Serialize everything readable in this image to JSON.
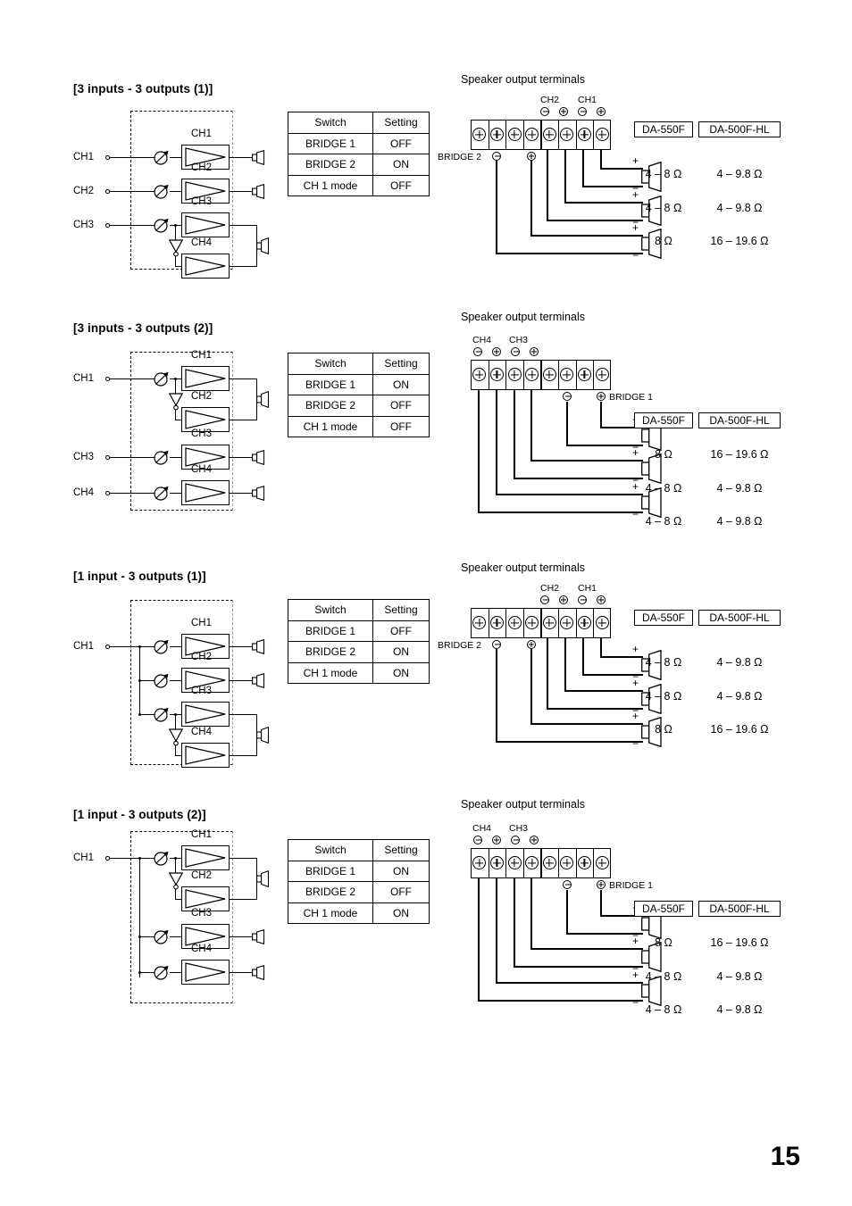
{
  "page": {
    "number": "15"
  },
  "common": {
    "speaker_terminals_label": "Speaker output terminals",
    "table_headers": {
      "switch": "Switch",
      "setting": "Setting"
    },
    "switch_names": {
      "bridge1": "BRIDGE 1",
      "bridge2": "BRIDGE 2",
      "ch1mode": "CH 1 mode"
    },
    "models": {
      "da550f": "DA-550F",
      "da500fhl": "DA-500F-HL"
    },
    "polarity": {
      "plus": "+",
      "minus": "−"
    },
    "channel_labels": {
      "ch1": "CH1",
      "ch2": "CH2",
      "ch3": "CH3",
      "ch4": "CH4"
    }
  },
  "sections": [
    {
      "title": "[3 inputs - 3 outputs (1)]",
      "speaker_terminals_label": "Speaker output terminals",
      "inputs": [
        "CH1",
        "CH2",
        "CH3"
      ],
      "amp_channels": [
        "CH1",
        "CH2",
        "CH3",
        "CH4"
      ],
      "bridged_pair": "CH3-CH4",
      "table": {
        "headers": [
          "Switch",
          "Setting"
        ],
        "rows": [
          {
            "switch": "BRIDGE 1",
            "setting": "OFF"
          },
          {
            "switch": "BRIDGE 2",
            "setting": "ON"
          },
          {
            "switch": "CH 1 mode",
            "setting": "OFF"
          }
        ]
      },
      "terminal_block": {
        "count": 8,
        "group_labels": [
          {
            "name": "CH2",
            "minus": "⊖",
            "plus": "⊕"
          },
          {
            "name": "CH1",
            "minus": "⊖",
            "plus": "⊕"
          }
        ],
        "bridge_label": "BRIDGE 2",
        "bridge_minus": "⊖",
        "bridge_plus": "⊕"
      },
      "impedance_header": [
        "DA-550F",
        "DA-500F-HL"
      ],
      "impedance_rows": [
        {
          "da550f": "4 – 8 Ω",
          "da500fhl": "4 – 9.8 Ω"
        },
        {
          "da550f": "4 – 8 Ω",
          "da500fhl": "4 – 9.8 Ω"
        },
        {
          "da550f": "8 Ω",
          "da500fhl": "16 – 19.6 Ω"
        }
      ]
    },
    {
      "title": "[3 inputs - 3 outputs (2)]",
      "speaker_terminals_label": "Speaker output terminals",
      "inputs": [
        "CH1",
        "CH3",
        "CH4"
      ],
      "amp_channels": [
        "CH1",
        "CH2",
        "CH3",
        "CH4"
      ],
      "bridged_pair": "CH1-CH2",
      "table": {
        "headers": [
          "Switch",
          "Setting"
        ],
        "rows": [
          {
            "switch": "BRIDGE 1",
            "setting": "ON"
          },
          {
            "switch": "BRIDGE 2",
            "setting": "OFF"
          },
          {
            "switch": "CH 1 mode",
            "setting": "OFF"
          }
        ]
      },
      "terminal_block": {
        "count": 8,
        "group_labels": [
          {
            "name": "CH4",
            "minus": "⊖",
            "plus": "⊕"
          },
          {
            "name": "CH3",
            "minus": "⊖",
            "plus": "⊕"
          }
        ],
        "bridge_label": "BRIDGE 1",
        "bridge_minus": "⊖",
        "bridge_plus": "⊕"
      },
      "impedance_header": [
        "DA-550F",
        "DA-500F-HL"
      ],
      "impedance_rows": [
        {
          "da550f": "8 Ω",
          "da500fhl": "16 – 19.6 Ω"
        },
        {
          "da550f": "4 – 8 Ω",
          "da500fhl": "4 – 9.8 Ω"
        },
        {
          "da550f": "4 – 8 Ω",
          "da500fhl": "4 – 9.8 Ω"
        }
      ]
    },
    {
      "title": "[1 input - 3 outputs (1)]",
      "speaker_terminals_label": "Speaker output terminals",
      "inputs": [
        "CH1"
      ],
      "amp_channels": [
        "CH1",
        "CH2",
        "CH3",
        "CH4"
      ],
      "bridged_pair": "CH3-CH4",
      "table": {
        "headers": [
          "Switch",
          "Setting"
        ],
        "rows": [
          {
            "switch": "BRIDGE 1",
            "setting": "OFF"
          },
          {
            "switch": "BRIDGE 2",
            "setting": "ON"
          },
          {
            "switch": "CH 1 mode",
            "setting": "ON"
          }
        ]
      },
      "terminal_block": {
        "count": 8,
        "group_labels": [
          {
            "name": "CH2",
            "minus": "⊖",
            "plus": "⊕"
          },
          {
            "name": "CH1",
            "minus": "⊖",
            "plus": "⊕"
          }
        ],
        "bridge_label": "BRIDGE 2",
        "bridge_minus": "⊖",
        "bridge_plus": "⊕"
      },
      "impedance_header": [
        "DA-550F",
        "DA-500F-HL"
      ],
      "impedance_rows": [
        {
          "da550f": "4 – 8 Ω",
          "da500fhl": "4 – 9.8 Ω"
        },
        {
          "da550f": "4 – 8 Ω",
          "da500fhl": "4 – 9.8 Ω"
        },
        {
          "da550f": "8 Ω",
          "da500fhl": "16 – 19.6 Ω"
        }
      ]
    },
    {
      "title": "[1 input - 3 outputs (2)]",
      "speaker_terminals_label": "Speaker output terminals",
      "inputs": [
        "CH1"
      ],
      "amp_channels": [
        "CH1",
        "CH2",
        "CH3",
        "CH4"
      ],
      "bridged_pair": "CH1-CH2",
      "table": {
        "headers": [
          "Switch",
          "Setting"
        ],
        "rows": [
          {
            "switch": "BRIDGE 1",
            "setting": "ON"
          },
          {
            "switch": "BRIDGE 2",
            "setting": "OFF"
          },
          {
            "switch": "CH 1 mode",
            "setting": "ON"
          }
        ]
      },
      "terminal_block": {
        "count": 8,
        "group_labels": [
          {
            "name": "CH4",
            "minus": "⊖",
            "plus": "⊕"
          },
          {
            "name": "CH3",
            "minus": "⊖",
            "plus": "⊕"
          }
        ],
        "bridge_label": "BRIDGE 1",
        "bridge_minus": "⊖",
        "bridge_plus": "⊕"
      },
      "impedance_header": [
        "DA-550F",
        "DA-500F-HL"
      ],
      "impedance_rows": [
        {
          "da550f": "8 Ω",
          "da500fhl": "16 – 19.6 Ω"
        },
        {
          "da550f": "4 – 8 Ω",
          "da500fhl": "4 – 9.8 Ω"
        },
        {
          "da550f": "4 – 8 Ω",
          "da500fhl": "4 – 9.8 Ω"
        }
      ]
    }
  ]
}
